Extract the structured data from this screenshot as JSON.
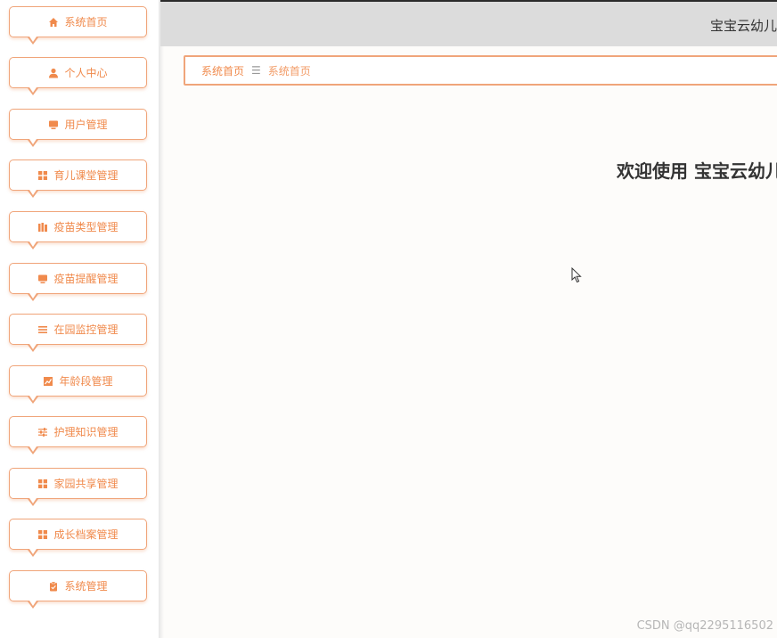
{
  "sidebar": {
    "items": [
      {
        "label": "系统首页",
        "icon": "home-icon"
      },
      {
        "label": "个人中心",
        "icon": "user-icon"
      },
      {
        "label": "用户管理",
        "icon": "monitor-icon"
      },
      {
        "label": "育儿课堂管理",
        "icon": "grid-icon"
      },
      {
        "label": "疫苗类型管理",
        "icon": "books-icon"
      },
      {
        "label": "疫苗提醒管理",
        "icon": "monitor-icon"
      },
      {
        "label": "在园监控管理",
        "icon": "list-icon"
      },
      {
        "label": "年龄段管理",
        "icon": "chart-icon"
      },
      {
        "label": "护理知识管理",
        "icon": "sliders-icon"
      },
      {
        "label": "家园共享管理",
        "icon": "grid-icon"
      },
      {
        "label": "成长档案管理",
        "icon": "grid-icon"
      },
      {
        "label": "系统管理",
        "icon": "clipboard-icon"
      }
    ]
  },
  "header": {
    "site_title": "宝宝云幼儿"
  },
  "breadcrumb": {
    "home": "系统首页",
    "separator": "☰",
    "current": "系统首页"
  },
  "main": {
    "welcome": "欢迎使用 宝宝云幼儿"
  },
  "watermark": "CSDN @qq2295116502",
  "colors": {
    "accent": "#f08a4c",
    "border": "#f0a57a",
    "topbar": "#dcdcdc"
  }
}
